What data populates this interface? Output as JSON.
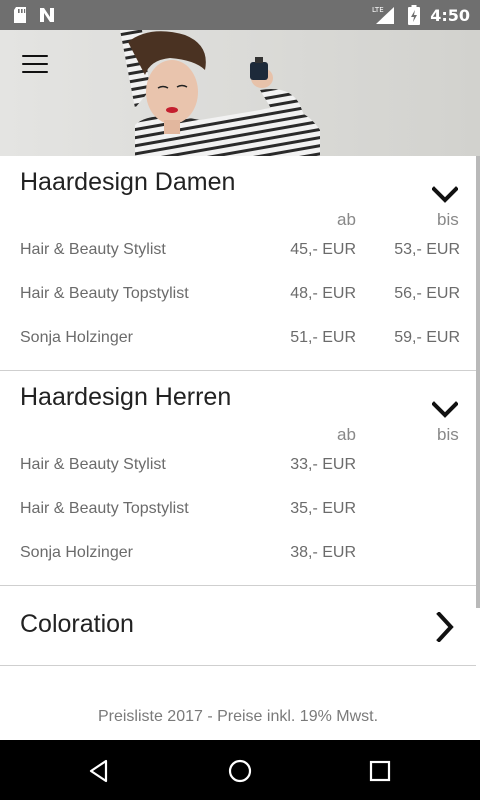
{
  "status_bar": {
    "icons": [
      "sd-card-icon",
      "n-notification-icon",
      "lte-signal-icon",
      "battery-charging-icon"
    ],
    "network": "LTE",
    "time": "4:50"
  },
  "header": {
    "menu_icon": "hamburger-menu-icon",
    "hero_image": "woman-with-perfume-photo"
  },
  "sections": [
    {
      "title": "Haardesign Damen",
      "expanded": true,
      "col_from": "ab",
      "col_to": "bis",
      "rows": [
        {
          "name": "Hair & Beauty Stylist",
          "from": "45,- EUR",
          "to": "53,- EUR"
        },
        {
          "name": "Hair & Beauty Topstylist",
          "from": "48,- EUR",
          "to": "56,- EUR"
        },
        {
          "name": "Sonja Holzinger",
          "from": "51,- EUR",
          "to": "59,- EUR"
        }
      ]
    },
    {
      "title": "Haardesign Herren",
      "expanded": true,
      "col_from": "ab",
      "col_to": "bis",
      "rows": [
        {
          "name": "Hair & Beauty Stylist",
          "from": "33,- EUR",
          "to": ""
        },
        {
          "name": "Hair & Beauty Topstylist",
          "from": "35,- EUR",
          "to": ""
        },
        {
          "name": "Sonja Holzinger",
          "from": "38,- EUR",
          "to": ""
        }
      ]
    },
    {
      "title": "Coloration",
      "expanded": false
    }
  ],
  "footer": {
    "note": "Preisliste 2017 - Preise inkl. 19% Mwst."
  },
  "nav_bar": {
    "icons": [
      "back-icon",
      "home-icon",
      "recents-icon"
    ]
  },
  "colors": {
    "status_bar": "#6f6f6f",
    "nav_bar": "#000000",
    "divider": "#cfcfcf",
    "text_secondary": "#6b6b6b"
  }
}
